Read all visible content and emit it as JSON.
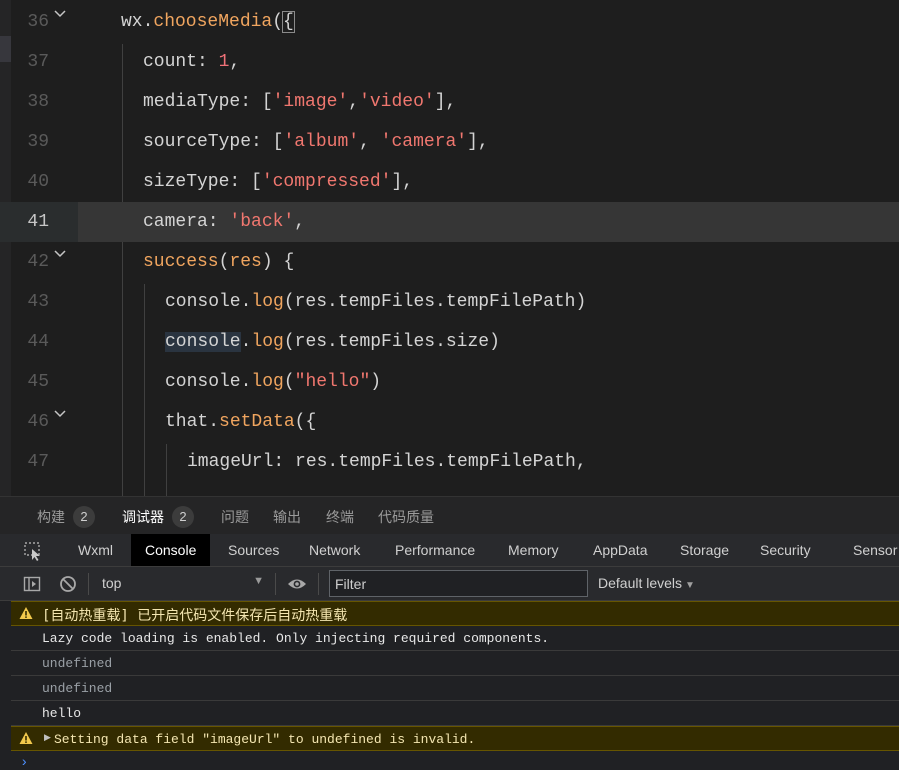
{
  "editor": {
    "lines": [
      {
        "num": "36"
      },
      {
        "num": "37"
      },
      {
        "num": "38"
      },
      {
        "num": "39"
      },
      {
        "num": "40"
      },
      {
        "num": "41"
      },
      {
        "num": "42"
      },
      {
        "num": "43"
      },
      {
        "num": "44"
      },
      {
        "num": "45"
      },
      {
        "num": "46"
      },
      {
        "num": "47"
      }
    ],
    "tokens": {
      "l36": [
        "wx.",
        "chooseMedia",
        "(",
        "{"
      ],
      "l37": [
        "count: ",
        "1",
        ","
      ],
      "l38": [
        "mediaType: [",
        "'image'",
        ",",
        "'video'",
        "],"
      ],
      "l39": [
        "sourceType: [",
        "'album'",
        ", ",
        "'camera'",
        "],"
      ],
      "l40": [
        "sizeType: [",
        "'compressed'",
        "],"
      ],
      "l41": [
        "camera: ",
        "'back'",
        ","
      ],
      "l42": [
        "success",
        "(",
        "res",
        ") {"
      ],
      "l43": [
        "console.",
        "log",
        "(res.tempFiles.tempFilePath)"
      ],
      "l44": [
        "console",
        ".",
        "log",
        "(res.tempFiles.size)"
      ],
      "l45": [
        "console.",
        "log",
        "(",
        "\"hello\"",
        ")"
      ],
      "l46": [
        "that.",
        "setData",
        "({"
      ],
      "l47": [
        "imageUrl: res.tempFiles.tempFilePath,"
      ]
    }
  },
  "panel_tabs": [
    {
      "label": "构建",
      "badge": "2"
    },
    {
      "label": "调试器",
      "badge": "2"
    },
    {
      "label": "问题"
    },
    {
      "label": "输出"
    },
    {
      "label": "终端"
    },
    {
      "label": "代码质量"
    }
  ],
  "devtools_tabs": [
    "Wxml",
    "Console",
    "Sources",
    "Network",
    "Performance",
    "Memory",
    "AppData",
    "Storage",
    "Security",
    "Sensor"
  ],
  "console_toolbar": {
    "context": "top",
    "filter_placeholder": "Filter",
    "levels": "Default levels"
  },
  "console_messages": [
    {
      "type": "warning",
      "text": "[自动热重载] 已开启代码文件保存后自动热重载"
    },
    {
      "type": "log",
      "text": "Lazy code loading is enabled. Only injecting required components."
    },
    {
      "type": "result",
      "text": "undefined"
    },
    {
      "type": "result",
      "text": "undefined"
    },
    {
      "type": "log",
      "text": "hello"
    },
    {
      "type": "warning",
      "text": "Setting data field \"imageUrl\" to undefined is invalid."
    }
  ],
  "colors": {
    "function": "#f0a55f",
    "string": "#f0776f",
    "number": "#f07178",
    "warning_bg": "#332b00",
    "active_tab_bg": "#000000"
  }
}
